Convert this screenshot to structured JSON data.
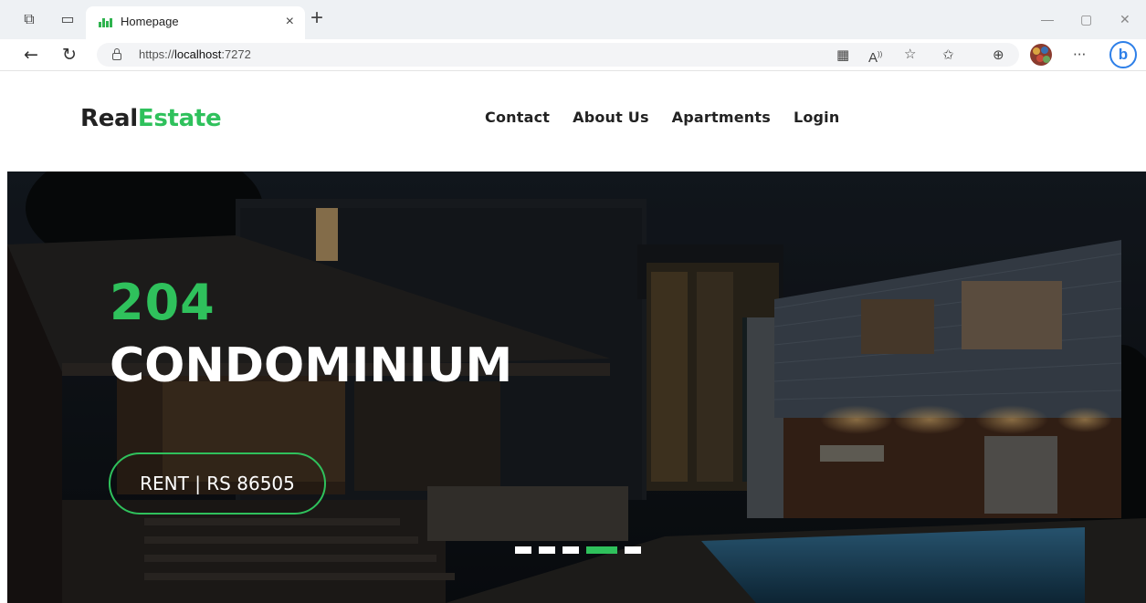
{
  "browser": {
    "tab_title": "Homepage",
    "tab_close": "×",
    "new_tab": "+",
    "url_prefix": "https://",
    "url_host": "localhost",
    "url_port": ":7272",
    "more": "···",
    "bing": "b"
  },
  "site": {
    "logo_part1": "Real",
    "logo_part2": "Estate",
    "nav": [
      "Contact",
      "About Us",
      "Apartments",
      "Login"
    ]
  },
  "hero": {
    "number": "204",
    "title": "CONDOMINIUM",
    "button": "RENT | RS 86505",
    "slides": 5,
    "active_slide": 4
  },
  "colors": {
    "accent": "#2fc15c",
    "dark_text": "#222222"
  }
}
